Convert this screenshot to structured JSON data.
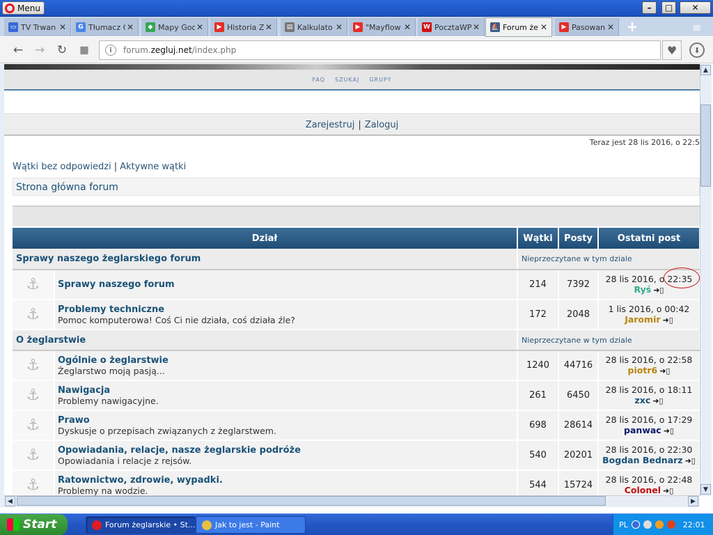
{
  "window": {
    "menu_label": "Menu",
    "controls": [
      "–",
      "□",
      "✕"
    ]
  },
  "tabs": [
    {
      "label": "TV Trwan",
      "favicon": "tv-icon",
      "active": false
    },
    {
      "label": "Tłumacz G",
      "favicon": "google-translate-icon",
      "active": false
    },
    {
      "label": "Mapy Goo",
      "favicon": "google-maps-icon",
      "active": false
    },
    {
      "label": "Historia Z",
      "favicon": "youtube-icon",
      "active": false
    },
    {
      "label": "Kalkulato",
      "favicon": "document-icon",
      "active": false
    },
    {
      "label": "\"Mayflow",
      "favicon": "youtube-icon",
      "active": false
    },
    {
      "label": "PocztaWP",
      "favicon": "wp-icon",
      "active": false
    },
    {
      "label": "Forum że",
      "favicon": "sail-icon",
      "active": true
    },
    {
      "label": "Pasowan",
      "favicon": "youtube-icon",
      "active": false
    }
  ],
  "address": {
    "prefix": "forum.",
    "domain": "zegluj.net",
    "path": "/index.php"
  },
  "forum": {
    "topnav": [
      "FAQ",
      "SZUKAJ",
      "GRUPY"
    ],
    "register": "Zarejestruj",
    "login": "Zaloguj",
    "now": "Teraz jest 28 lis 2016, o 22:5",
    "unanswered": "Wątki bez odpowiedzi",
    "active_topics": "Aktywne wątki",
    "breadcrumb": "Strona główna forum",
    "columns": {
      "section": "Dział",
      "topics": "Wątki",
      "posts": "Posty",
      "last_post": "Ostatni post"
    },
    "categories": [
      {
        "name": "Sprawy naszego żeglarskiego forum",
        "unread_label": "Nieprzeczytane w tym dziale",
        "forums": [
          {
            "title": "Sprawy naszego forum",
            "desc": "",
            "topics": "214",
            "posts": "7392",
            "last_date": "28 lis 2016, o 22:35",
            "last_user": "Ryś",
            "user_color": "#2fa88a"
          },
          {
            "title": "Problemy techniczne",
            "desc": "Pomoc komputerowa! Coś Ci nie działa, coś działa źle?",
            "topics": "172",
            "posts": "2048",
            "last_date": "1 lis 2016, o 00:42",
            "last_user": "Jaromir",
            "user_color": "#b8860b"
          }
        ]
      },
      {
        "name": "O żeglarstwie",
        "unread_label": "Nieprzeczytane w tym dziale",
        "forums": [
          {
            "title": "Ogólnie o żeglarstwie",
            "desc": "Żeglarstwo moją pasją...",
            "topics": "1240",
            "posts": "44716",
            "last_date": "28 lis 2016, o 22:58",
            "last_user": "piotr6",
            "user_color": "#b8860b"
          },
          {
            "title": "Nawigacja",
            "desc": "Problemy nawigacyjne.",
            "topics": "261",
            "posts": "6450",
            "last_date": "28 lis 2016, o 18:11",
            "last_user": "zxc",
            "user_color": "#1a5278"
          },
          {
            "title": "Prawo",
            "desc": "Dyskusje o przepisach związanych z żeglarstwem.",
            "topics": "698",
            "posts": "28614",
            "last_date": "28 lis 2016, o 17:29",
            "last_user": "panwac",
            "user_color": "#0a1a6a"
          },
          {
            "title": "Opowiadania, relacje, nasze żeglarskie podróże",
            "desc": "Opowiadania i relacje z rejsów.",
            "topics": "540",
            "posts": "20201",
            "last_date": "28 lis 2016, o 22:30",
            "last_user": "Bogdan Bednarz",
            "user_color": "#1a5278"
          },
          {
            "title": "Ratownictwo, zdrowie, wypadki.",
            "desc": "Problemy na wodzie.",
            "topics": "544",
            "posts": "15724",
            "last_date": "28 lis 2016, o 22:48",
            "last_user": "Colonel",
            "user_color": "#c01010"
          }
        ]
      }
    ]
  },
  "taskbar": {
    "start": "Start",
    "items": [
      {
        "label": "Forum żeglarskie • St...",
        "icon": "opera-icon",
        "active": true
      },
      {
        "label": "Jak to jest - Paint",
        "icon": "paint-icon",
        "active": false
      }
    ],
    "lang": "PL",
    "clock": "22:01"
  }
}
